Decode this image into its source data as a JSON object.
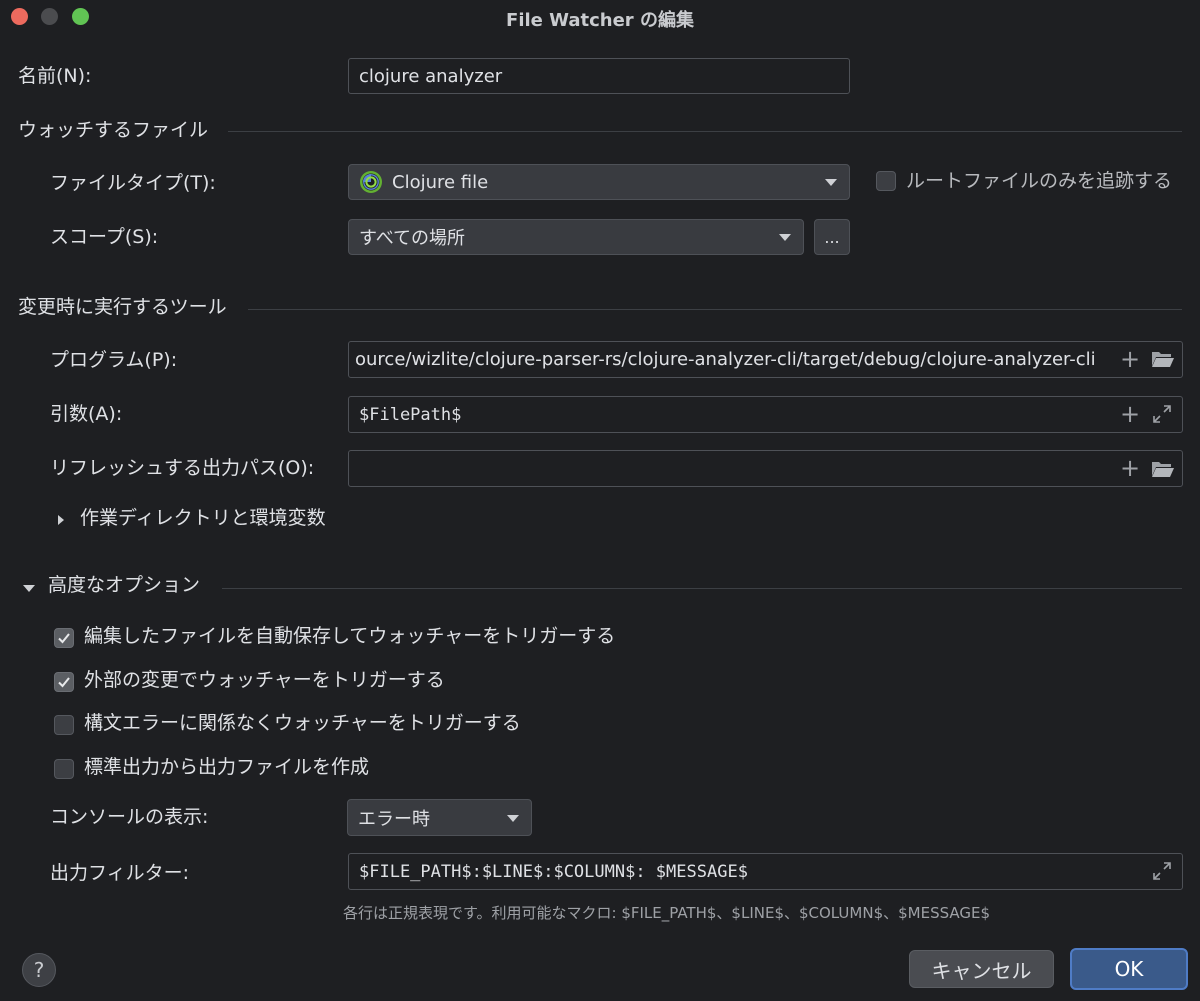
{
  "window": {
    "title": "File Watcher の編集"
  },
  "name": {
    "label": "名前(N):",
    "value": "clojure analyzer"
  },
  "watch_files": {
    "section_title": "ウォッチするファイル",
    "file_type": {
      "label": "ファイルタイプ(T):",
      "value": "Clojure file",
      "icon": "clojure-icon"
    },
    "track_root_only": {
      "label": "ルートファイルのみを追跡する",
      "checked": false
    },
    "scope": {
      "label": "スコープ(S):",
      "value": "すべての場所",
      "more_button": "..."
    }
  },
  "tool": {
    "section_title": "変更時に実行するツール",
    "program": {
      "label": "プログラム(P):",
      "value": "ource/wizlite/clojure-parser-rs/clojure-analyzer-cli/target/debug/clojure-analyzer-cli"
    },
    "arguments": {
      "label": "引数(A):",
      "value": "$FilePath$"
    },
    "output_paths": {
      "label": "リフレッシュする出力パス(O):",
      "value": ""
    },
    "working_dir": {
      "label": "作業ディレクトリと環境変数",
      "expanded": false
    }
  },
  "advanced": {
    "section_title": "高度なオプション",
    "expanded": true,
    "options": [
      {
        "label": "編集したファイルを自動保存してウォッチャーをトリガーする",
        "checked": true
      },
      {
        "label": "外部の変更でウォッチャーをトリガーする",
        "checked": true
      },
      {
        "label": "構文エラーに関係なくウォッチャーをトリガーする",
        "checked": false
      },
      {
        "label": "標準出力から出力ファイルを作成",
        "checked": false
      }
    ],
    "console": {
      "label": "コンソールの表示:",
      "value": "エラー時"
    },
    "output_filter": {
      "label": "出力フィルター:",
      "value": "$FILE_PATH$:$LINE$:$COLUMN$: $MESSAGE$",
      "hint": "各行は正規表現です。利用可能なマクロ: $FILE_PATH$、$LINE$、$COLUMN$、$MESSAGE$"
    }
  },
  "footer": {
    "help": "?",
    "cancel": "キャンセル",
    "ok": "OK"
  },
  "colors": {
    "background": "#1e1f22",
    "accent": "#4f7cc6",
    "traffic_red": "#ed6a5e",
    "traffic_green": "#61c454"
  }
}
